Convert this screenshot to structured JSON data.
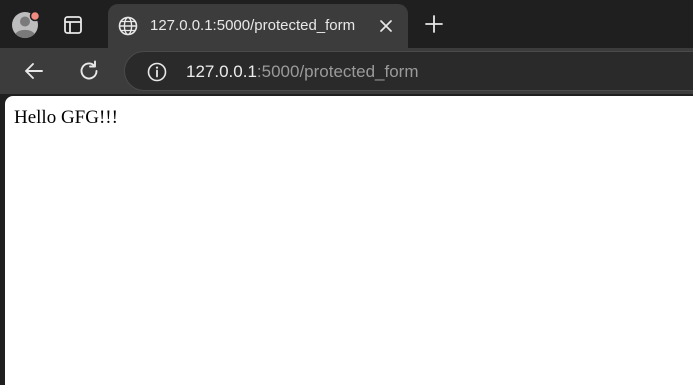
{
  "browser": {
    "tab": {
      "title": "127.0.0.1:5000/protected_form",
      "favicon": "globe-icon",
      "close": "close-icon"
    },
    "new_tab": "plus-icon",
    "profile": "avatar-icon",
    "tab_actions": "tab-actions-icon"
  },
  "toolbar": {
    "back": "arrow-left-icon",
    "reload": "reload-icon",
    "site_info": "info-icon",
    "url_host": "127.0.0.1",
    "url_rest": ":5000/protected_form"
  },
  "page": {
    "text": "Hello GFG!!!"
  },
  "colors": {
    "tabstrip_bg": "#1f1f1f",
    "toolbar_bg": "#3c3c3c",
    "notification_dot": "#f28b82",
    "page_bg": "#ffffff"
  }
}
